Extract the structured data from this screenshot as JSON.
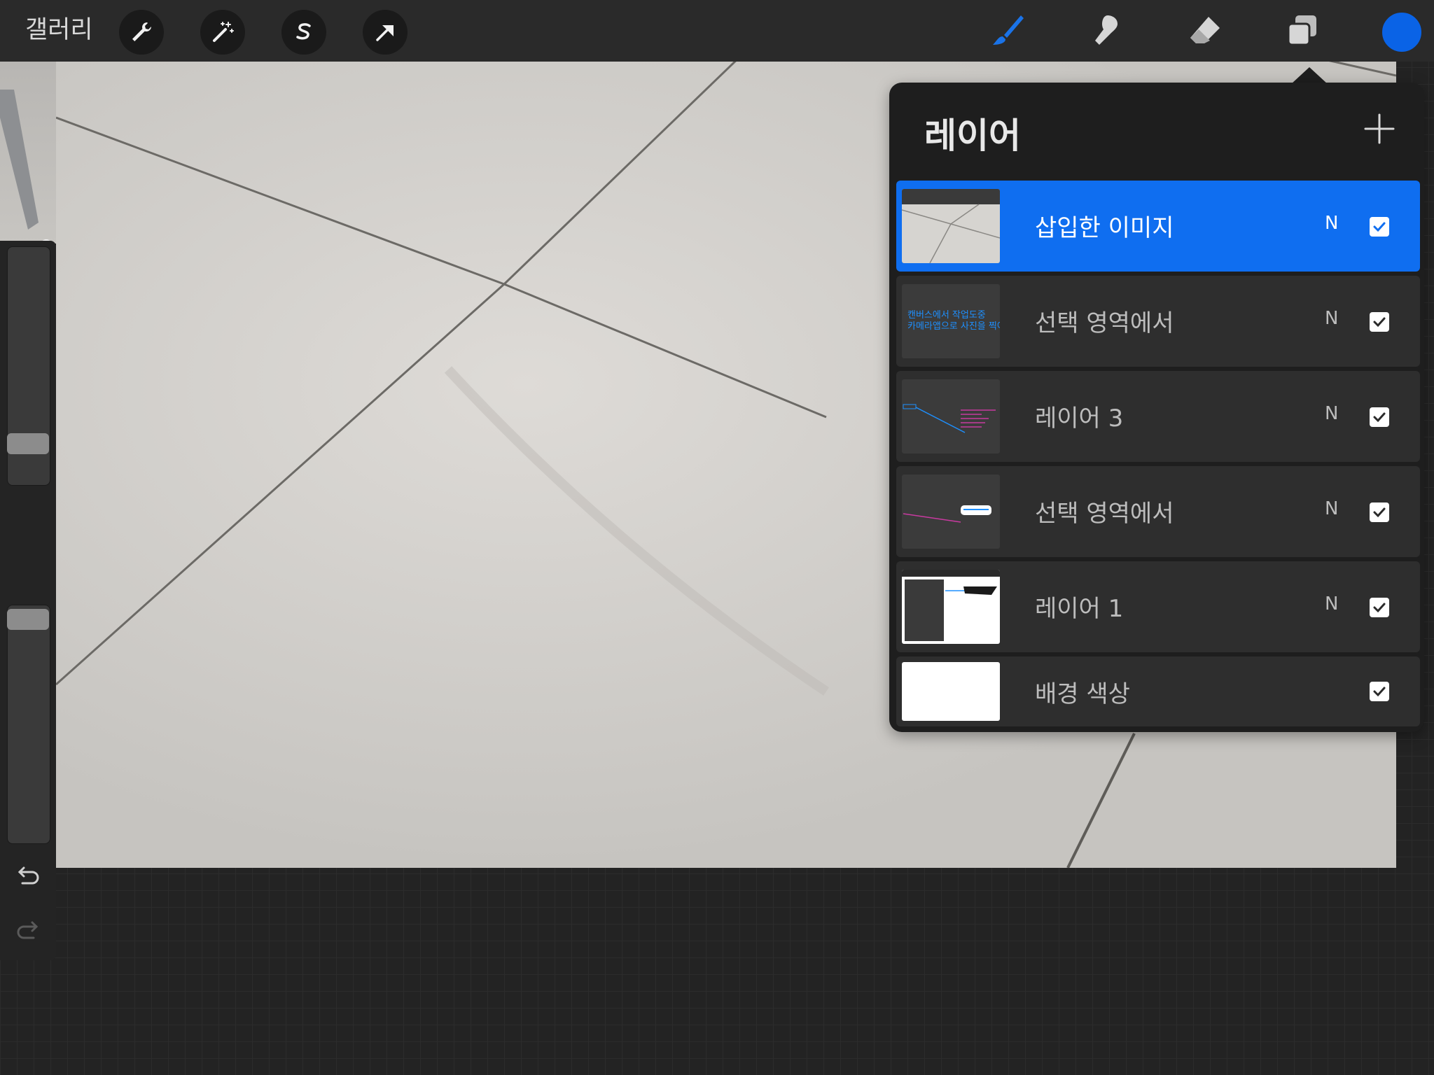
{
  "toolbar": {
    "gallery_label": "갤러리",
    "left_buttons": [
      "wrench-icon",
      "magic-wand-icon",
      "selection-s-icon",
      "arrow-transform-icon"
    ],
    "right_tools": [
      "brush-icon",
      "smudge-icon",
      "eraser-icon",
      "layers-icon"
    ],
    "current_color": "#0a63e6"
  },
  "sidebar": {
    "brush_size_level": 0.14,
    "opacity_level": 0.98,
    "undo_icon": "undo-icon",
    "redo_icon": "redo-icon"
  },
  "layers_panel": {
    "title": "레이어",
    "add_icon": "plus-icon",
    "layers": [
      {
        "name": "삽입한 이미지",
        "blend": "N",
        "visible": true,
        "active": true
      },
      {
        "name": "선택 영역에서",
        "blend": "N",
        "visible": true,
        "active": false
      },
      {
        "name": "레이어 3",
        "blend": "N",
        "visible": true,
        "active": false
      },
      {
        "name": "선택 영역에서",
        "blend": "N",
        "visible": true,
        "active": false
      },
      {
        "name": "레이어 1",
        "blend": "N",
        "visible": true,
        "active": false
      }
    ],
    "background": {
      "name": "배경 색상",
      "visible": true,
      "color": "#ffffff"
    },
    "layer2_thumb_text": [
      "캔버스에서 작업도중",
      "카메라앱으로 사진을 찍어"
    ]
  },
  "colors": {
    "accent": "#0f6ef0",
    "panel_bg": "#1e1e1e",
    "layer_bg": "#2e2e2e"
  }
}
